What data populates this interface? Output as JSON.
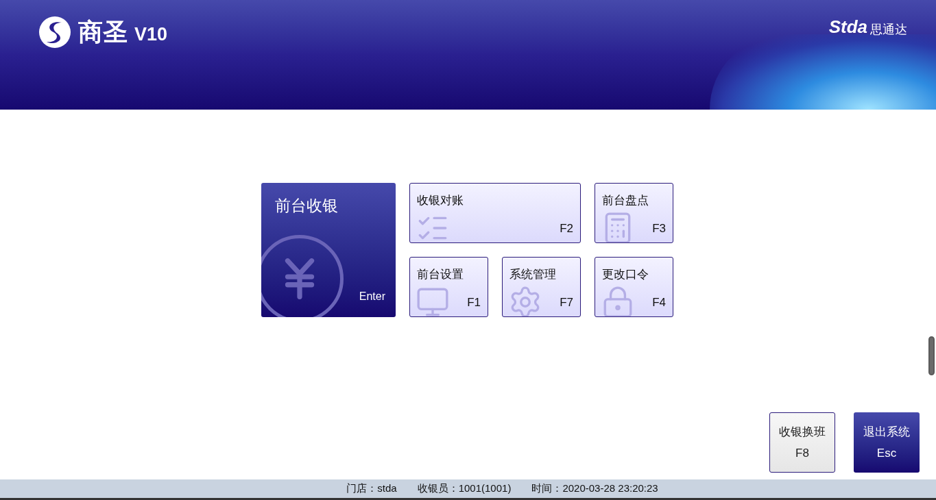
{
  "header": {
    "brand": "商圣",
    "version": "V10",
    "partner_latin": "Stda",
    "partner_cn": "思通达"
  },
  "main_tile": {
    "label": "前台收银",
    "key": "Enter",
    "kind": "yen"
  },
  "tiles": [
    {
      "label": "收银对账",
      "key": "F2",
      "kind": "checklist"
    },
    {
      "label": "前台盘点",
      "key": "F3",
      "kind": "register"
    },
    {
      "label": "前台设置",
      "key": "F1",
      "kind": "monitor"
    },
    {
      "label": "系统管理",
      "key": "F7",
      "kind": "gear"
    },
    {
      "label": "更改口令",
      "key": "F4",
      "kind": "lock"
    }
  ],
  "bottom_buttons": [
    {
      "label": "收银换班",
      "key": "F8",
      "kind": "light"
    },
    {
      "label": "退出系统",
      "key": "Esc",
      "kind": "dark"
    }
  ],
  "status_bar": [
    "门店：stda",
    "收银员：1001(1001)",
    "时间：2020-03-28 23:20:23"
  ]
}
